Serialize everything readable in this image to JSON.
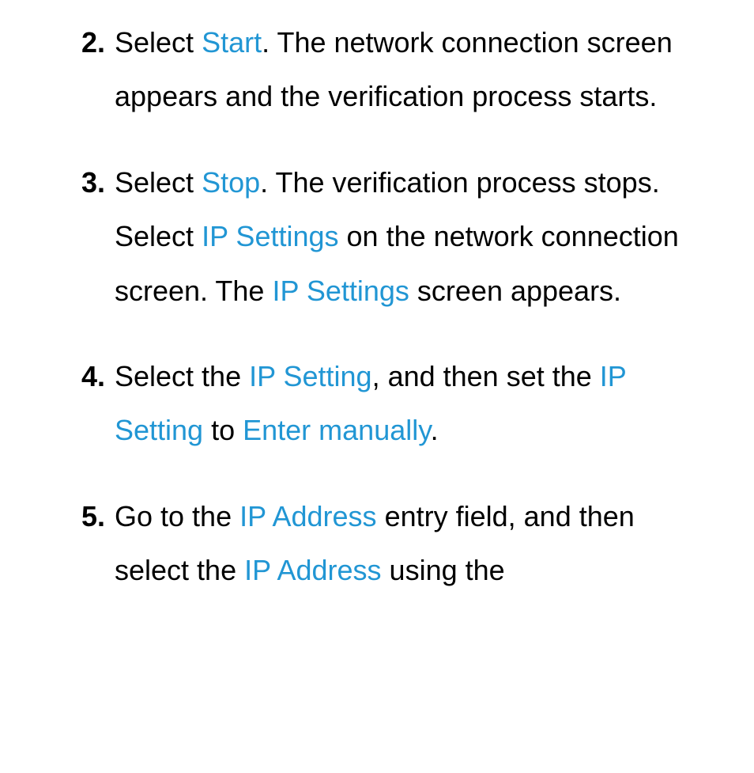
{
  "items": [
    {
      "num": "2.",
      "parts": [
        {
          "t": "Select ",
          "hl": false
        },
        {
          "t": "Start",
          "hl": true
        },
        {
          "t": ". The network connection screen appears and the verification process starts.",
          "hl": false
        }
      ]
    },
    {
      "num": "3.",
      "parts": [
        {
          "t": "Select ",
          "hl": false
        },
        {
          "t": "Stop",
          "hl": true
        },
        {
          "t": ". The verification process stops. Select ",
          "hl": false
        },
        {
          "t": "IP Settings",
          "hl": true
        },
        {
          "t": " on the network connection screen. The ",
          "hl": false
        },
        {
          "t": "IP Settings",
          "hl": true
        },
        {
          "t": " screen appears.",
          "hl": false
        }
      ]
    },
    {
      "num": "4.",
      "parts": [
        {
          "t": "Select the ",
          "hl": false
        },
        {
          "t": "IP Setting",
          "hl": true
        },
        {
          "t": ", and then set the ",
          "hl": false
        },
        {
          "t": "IP Setting",
          "hl": true
        },
        {
          "t": " to ",
          "hl": false
        },
        {
          "t": "Enter manually",
          "hl": true
        },
        {
          "t": ".",
          "hl": false
        }
      ]
    },
    {
      "num": "5.",
      "parts": [
        {
          "t": "Go to the ",
          "hl": false
        },
        {
          "t": "IP Address",
          "hl": true
        },
        {
          "t": " entry field, and then select the ",
          "hl": false
        },
        {
          "t": "IP Address",
          "hl": true
        },
        {
          "t": " using the",
          "hl": false
        }
      ]
    }
  ]
}
